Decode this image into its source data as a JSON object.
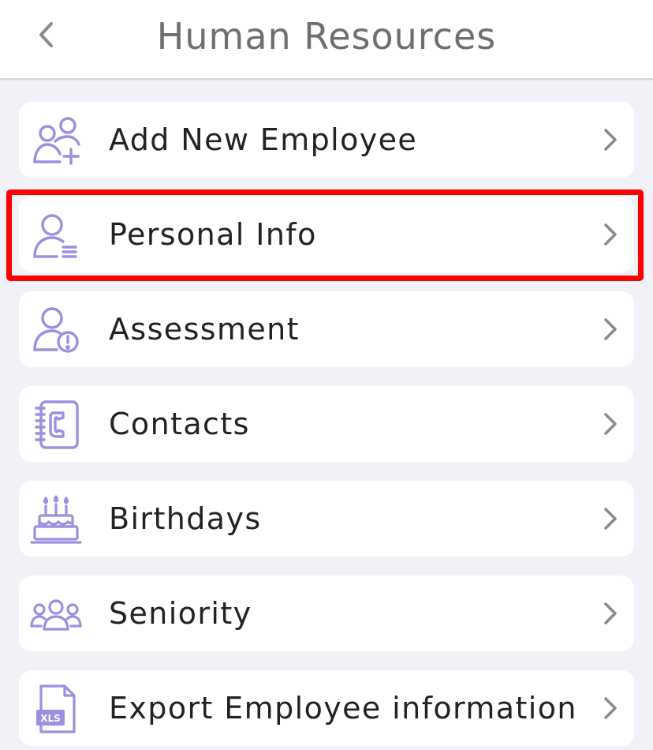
{
  "header": {
    "title": "Human Resources",
    "back_icon": "chevron-left-icon"
  },
  "menu": {
    "items": [
      {
        "label": "Add New Employee",
        "icon": "add-user-icon"
      },
      {
        "label": "Personal Info",
        "icon": "user-list-icon",
        "highlighted": true
      },
      {
        "label": "Assessment",
        "icon": "user-alert-icon"
      },
      {
        "label": "Contacts",
        "icon": "phonebook-icon"
      },
      {
        "label": "Birthdays",
        "icon": "birthday-cake-icon"
      },
      {
        "label": "Seniority",
        "icon": "group-icon"
      },
      {
        "label": "Export Employee information",
        "icon": "xls-file-icon"
      }
    ]
  },
  "colors": {
    "accent": "#9d8ee0",
    "highlight": "#ff0000",
    "background": "#f2f1f8",
    "text": "#222226",
    "title": "#6e6e70"
  }
}
